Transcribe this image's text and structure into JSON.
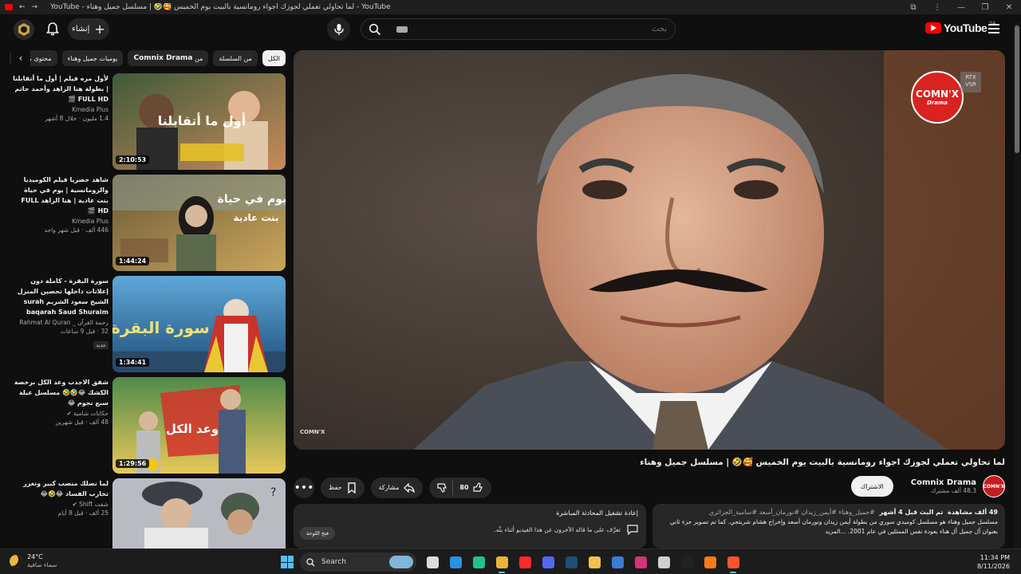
{
  "browser": {
    "tab_title": "YouTube - لما تحاولي تعملي لجوزك اجواء رومانسية بالبيت يوم الخميس 🥰🤣 | مسلسل جميل وهناء - YouTube",
    "controls": [
      "—",
      "❐",
      "✕"
    ]
  },
  "header": {
    "create_label": "إنشاء",
    "search_placeholder": "بحث",
    "brand": "YouTube",
    "brand_region": "SA"
  },
  "chips": [
    {
      "label": "الكل",
      "active": true
    },
    {
      "label": "من السلسلة",
      "active": false
    },
    {
      "label_prefix": "من",
      "label_strong": "Comnix Drama",
      "active": false
    },
    {
      "label": "يوميات جميل وهناء",
      "active": false
    },
    {
      "label": "محتوى مشابه",
      "active": false
    }
  ],
  "recommendations": [
    {
      "title": "لأول مره فيلم | أول ما أتقابلنا | بطولة هنا الزاهد وأحمد حاتم FULL HD 🎬",
      "channel": "Kmedia Plus",
      "meta": "1.4 مليون · خلال 8 أشهر",
      "duration": "2:10:53",
      "thumb_text": "أول ما أتقابلنا",
      "thumb_colors": [
        "#3f5a3a",
        "#c88a5a"
      ]
    },
    {
      "title": "شاهد حصريا فيلم الكوميديا والرومانسية | يوم في حياة بنت عادية | هنا الزاهد FULL HD 🎬",
      "channel": "Kmedia Plus",
      "meta": "446 ألف · قبل شهر واحد",
      "duration": "1:44:24",
      "thumb_text": "يوم في حياة بنت عادية",
      "thumb_colors": [
        "#6a5a3a",
        "#caa65a"
      ]
    },
    {
      "title": "سورة البقرة - كاملة دون إعلانات داخلها تحصين المنزل الشيخ سعود الشريم surah baqarah Saud Shuraim",
      "channel": "رحمة القرآن _ Rahmat Al Quran",
      "meta": "32 · قبل 9 ساعات",
      "badge": "جديد",
      "duration": "1:34:41",
      "thumb_text": "سورة البقرة",
      "thumb_colors": [
        "#2f6fa3",
        "#d8c35a"
      ]
    },
    {
      "title": "شفق الاجدب وعد الكل برخصة الكشك 😂🤣🤣 مسلسل عيلة سبع نجوم 😂",
      "channel": "حكايات شامية ✔",
      "meta": "48 ألف · قبل شهرين",
      "duration": "1:29:56",
      "thumb_text": "وعد الكل",
      "thumb_colors": [
        "#3a6a3a",
        "#d24a3a"
      ]
    },
    {
      "title": "لما تصلك منصب كبير وتغرر تحارب الفساد 😂🤣😂",
      "channel": "شفت Shift ✔",
      "meta": "25 ألف · قبل 8 أيام",
      "duration": "",
      "thumb_text": "",
      "thumb_colors": [
        "#7a7f86",
        "#c9ccd1"
      ]
    }
  ],
  "player": {
    "logo_text": "COMN'X",
    "logo_sub": "Drama",
    "rtx_label": "RTX VSR",
    "watermark": "COMN'X"
  },
  "video": {
    "title": "لما تحاولي تعملي لجوزك اجواء رومانسية بالبيت يوم الخميس 🥰🤣 | مسلسل جميل وهناء",
    "channel_name": "Comnix Drama",
    "subscribers": "48.3 ألف مشترك",
    "avatar_text": "COMN'X",
    "subscribe_label": "الاشتراك",
    "likes": "80",
    "share_label": "مشاركة",
    "save_label": "حفظ",
    "more_label": "•••"
  },
  "description": {
    "views": "49 ألف مشاهدة",
    "date": "تم البث قبل 4 أشهر",
    "tags": "#جميل_وهناء #أيمن_زيدان #نورمان_أسعد #سامية_الجزائري",
    "text": "مسلسل جميل وهناء هو مسلسل كوميدي سوري من بطولة أيمن زيدان ونورمان أسعد وإخراج هشام شربتجي. كما تم تصوير جزء ثاني بعنوان أل جميل أل هناء بعودة نفس الممثلين في عام 2001. ...المزيد"
  },
  "live_chat": {
    "title": "إعادة تشغيل المحادثة المباشرة",
    "desc": "تعرَّف على ما قاله الآخرون عن هذا الفيديو أثناء بثّه.",
    "open_label": "فتح اللوحة"
  },
  "taskbar": {
    "temp": "24°C",
    "condition": "سماء صافية",
    "search_label": "Search",
    "time": "11:34 PM",
    "date": "8/11/2026",
    "apps": [
      {
        "name": "task-view-icon",
        "color": "#dcdcdc"
      },
      {
        "name": "store-icon",
        "color": "#2f8fe0"
      },
      {
        "name": "greenapp-icon",
        "color": "#24c08a"
      },
      {
        "name": "chrome-icon",
        "color": "#e9b43a",
        "active": true
      },
      {
        "name": "youtube-app-icon",
        "color": "#ff2a2a"
      },
      {
        "name": "discord-icon",
        "color": "#5865f2"
      },
      {
        "name": "steam-icon",
        "color": "#1b4f7a"
      },
      {
        "name": "folder-icon",
        "color": "#f2c14e"
      },
      {
        "name": "app-w-icon",
        "color": "#3a7bd5"
      },
      {
        "name": "instagram-icon",
        "color": "#d6337a"
      },
      {
        "name": "obs-icon",
        "color": "#cfcfcf"
      },
      {
        "name": "tiktok-icon",
        "color": "#222222"
      },
      {
        "name": "soundcloud-icon",
        "color": "#ff7a1a"
      },
      {
        "name": "brave-icon",
        "color": "#fb542b",
        "active": true
      }
    ]
  }
}
